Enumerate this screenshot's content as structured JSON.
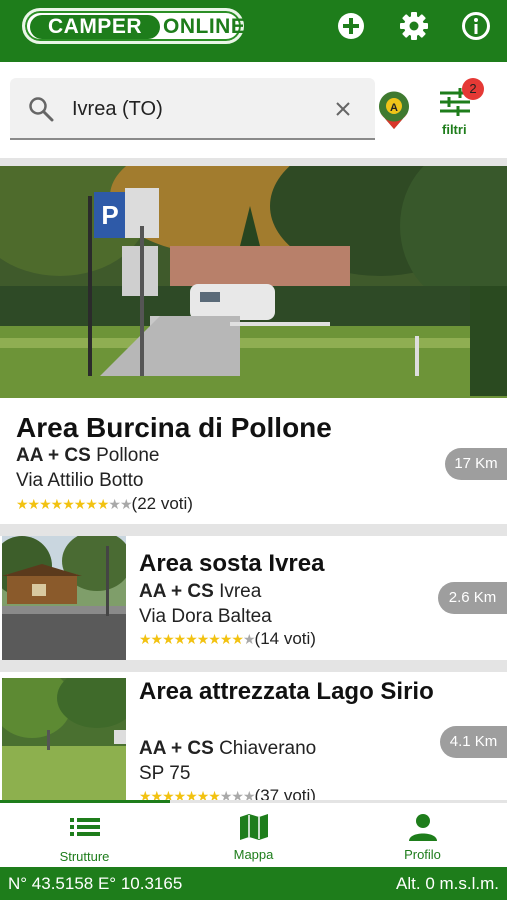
{
  "header": {
    "logo_part1": "CAMPER",
    "logo_part2": "ONLINE",
    "add_icon": "plus-circle-icon",
    "settings_icon": "gear-icon",
    "info_icon": "info-icon"
  },
  "search": {
    "value": "Ivrea (TO)",
    "filter_label": "filtri",
    "filter_count": "2"
  },
  "featured": {
    "title": "Area Burcina di Pollone",
    "type": "AA + CS",
    "city": "Pollone",
    "address": "Via Attilio Botto",
    "rating": 8,
    "votes": "(22 voti)",
    "distance": "17 Km"
  },
  "results": [
    {
      "title": "Area sosta Ivrea",
      "type": "AA + CS",
      "city": "Ivrea",
      "address": "Via Dora Baltea",
      "rating": 9,
      "votes": "(14 voti)",
      "distance": "2.6 Km"
    },
    {
      "title": "Area attrezzata Lago Sirio",
      "type": "AA + CS",
      "city": "Chiaverano",
      "address": "SP 75",
      "rating": 7,
      "votes": "(37 voti)",
      "distance": "4.1 Km"
    }
  ],
  "nav": {
    "strutture": "Strutture",
    "mappa": "Mappa",
    "profilo": "Profilo"
  },
  "status": {
    "coords": "N° 43.5158 E° 10.3165",
    "altitude": "Alt. 0 m.s.l.m."
  },
  "colors": {
    "brand": "#1e7d1b",
    "star": "#f2c211",
    "badge": "#e53935"
  }
}
